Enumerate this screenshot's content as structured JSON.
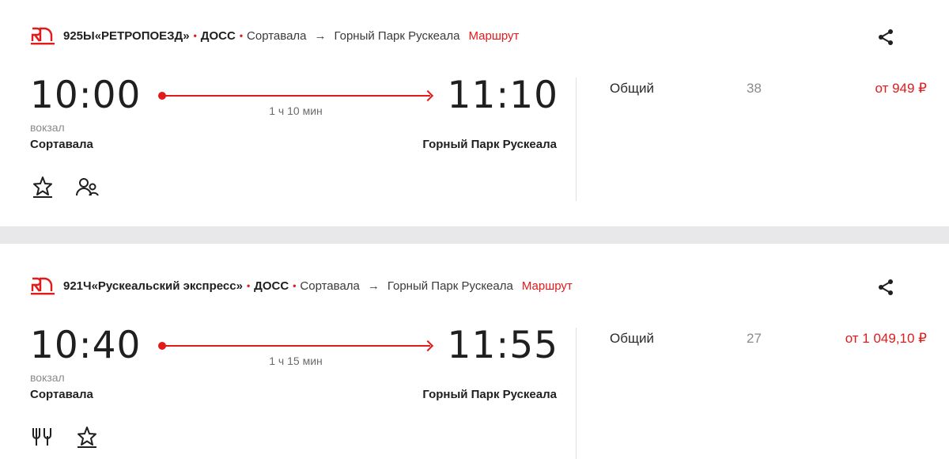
{
  "colors": {
    "accent": "#e21a1a",
    "divider": "#e8e8ea",
    "text": "#1f1f1f",
    "muted": "#8a8a8a"
  },
  "trains": [
    {
      "name": "925Ы«РЕТРОПОЕЗД»",
      "carrier": "ДОСС",
      "route_from": "Сортавала",
      "route_arrow": "→",
      "route_to": "Горный Парк Рускеала",
      "route_link": "Маршрут",
      "departure_time": "10:00",
      "arrival_time": "11:10",
      "duration": "1 ч 10 мин",
      "departure_station_type": "вокзал",
      "departure_station": "Сортавала",
      "arrival_station": "Горный Парк Рускеала",
      "icons": [
        "premium-star-icon",
        "passengers-icon"
      ],
      "fares": [
        {
          "class": "Общий",
          "seats": "38",
          "price": "от 949 ₽"
        }
      ]
    },
    {
      "name": "921Ч«Рускеальский экспресс»",
      "carrier": "ДОСС",
      "route_from": "Сортавала",
      "route_arrow": "→",
      "route_to": "Горный Парк Рускеала",
      "route_link": "Маршрут",
      "departure_time": "10:40",
      "arrival_time": "11:55",
      "duration": "1 ч 15 мин",
      "departure_station_type": "вокзал",
      "departure_station": "Сортавала",
      "arrival_station": "Горный Парк Рускеала",
      "icons": [
        "restaurant-icon",
        "premium-star-icon"
      ],
      "fares": [
        {
          "class": "Общий",
          "seats": "27",
          "price": "от 1 049,10 ₽"
        }
      ]
    }
  ]
}
